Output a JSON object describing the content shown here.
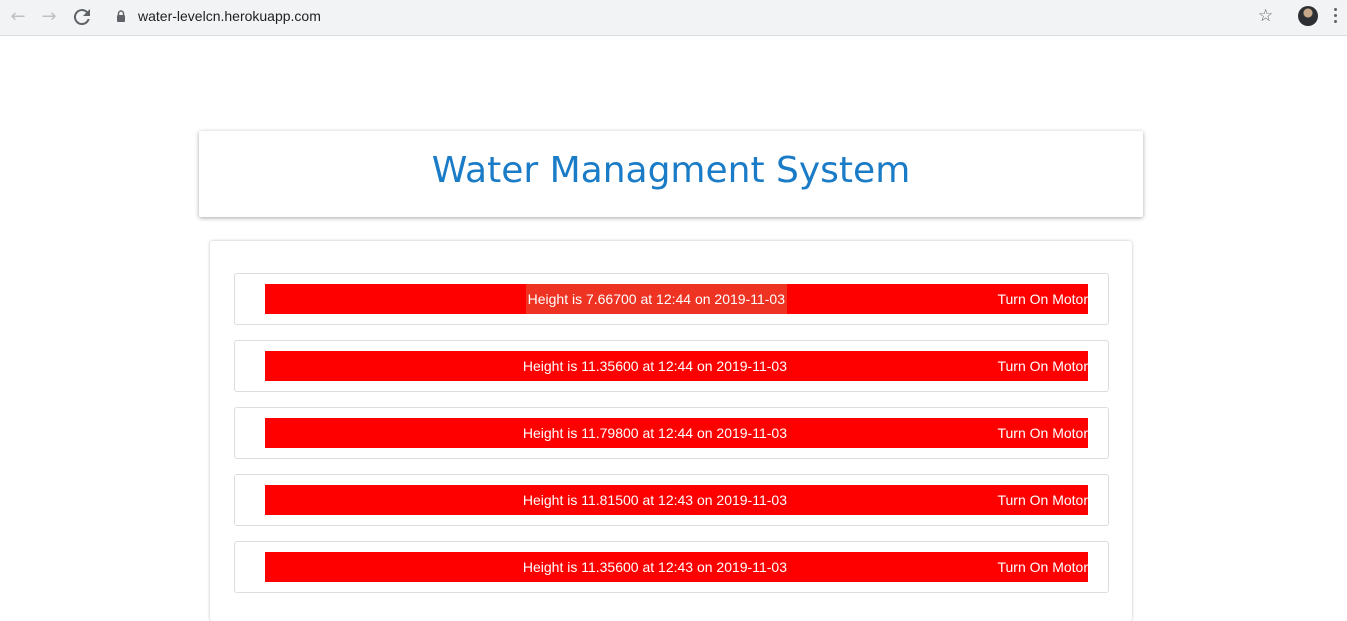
{
  "browser": {
    "url": "water-levelcn.herokuapp.com"
  },
  "header": {
    "title": "Water Managment System"
  },
  "readings": [
    {
      "text": "Height is 7.66700 at 12:44 on 2019-11-03",
      "action": "Turn On Motor"
    },
    {
      "text": "Height is 11.35600 at 12:44 on 2019-11-03",
      "action": "Turn On Motor"
    },
    {
      "text": "Height is 11.79800 at 12:44 on 2019-11-03",
      "action": "Turn On Motor"
    },
    {
      "text": "Height is 11.81500 at 12:43 on 2019-11-03",
      "action": "Turn On Motor"
    },
    {
      "text": "Height is 11.35600 at 12:43 on 2019-11-03",
      "action": "Turn On Motor"
    }
  ],
  "colors": {
    "title": "#1a7bc7",
    "reading_bar": "#ff0000"
  },
  "icons": [
    "back-arrow-icon",
    "forward-arrow-icon",
    "reload-icon",
    "lock-icon",
    "star-icon",
    "profile-avatar-icon",
    "more-menu-icon"
  ]
}
